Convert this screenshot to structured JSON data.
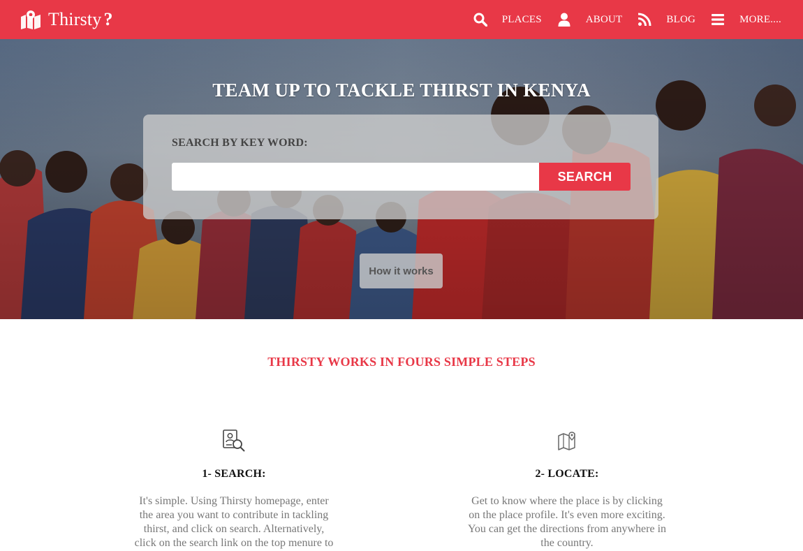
{
  "brand": {
    "name": "Thirsty",
    "mark": "?",
    "icon": "map-marker-icon"
  },
  "nav": {
    "items": [
      {
        "label": "PLACES",
        "icon": "search-icon"
      },
      {
        "label": "ABOUT",
        "icon": "user-icon"
      },
      {
        "label": "BLOG",
        "icon": "rss-icon"
      },
      {
        "label": "MORE....",
        "icon": "menu-icon"
      }
    ]
  },
  "hero": {
    "title": "TEAM UP TO TACKLE THIRST IN KENYA",
    "search_label": "SEARCH BY KEY WORD:",
    "search_value": "",
    "search_placeholder": "",
    "search_button": "SEARCH",
    "how_button": "How it works"
  },
  "steps": {
    "title": "THIRSTY WORKS IN FOURS SIMPLE STEPS",
    "items": [
      {
        "heading": "1- SEARCH:",
        "icon": "document-search-icon",
        "text": "It's simple. Using Thirsty homepage, enter the area you want to contribute in tackling thirst, and click on search. Alternatively, click on the search link on the top menure to"
      },
      {
        "heading": "2- LOCATE:",
        "icon": "map-pin-icon",
        "text": "Get to know where the place is by clicking on the place profile. It's even more exciting. You can get the directions from anywhere in the country."
      }
    ]
  },
  "colors": {
    "accent": "#e83847",
    "panel": "#cdcdcd",
    "body_text": "#777777"
  }
}
